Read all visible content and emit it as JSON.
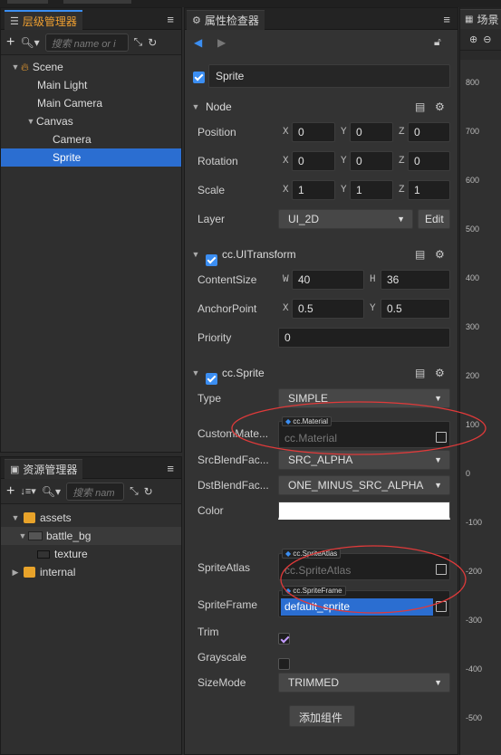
{
  "hierarchy": {
    "tab_label": "层级管理器",
    "search_placeholder": "搜索 name or i",
    "items": [
      {
        "label": "Scene",
        "depth": 0
      },
      {
        "label": "Main Light",
        "depth": 1
      },
      {
        "label": "Main Camera",
        "depth": 1
      },
      {
        "label": "Canvas",
        "depth": 1
      },
      {
        "label": "Camera",
        "depth": 2
      },
      {
        "label": "Sprite",
        "depth": 2,
        "selected": true
      }
    ]
  },
  "assets": {
    "tab_label": "资源管理器",
    "search_placeholder": "搜索 nam",
    "items": [
      {
        "label": "assets"
      },
      {
        "label": "battle_bg"
      },
      {
        "label": "texture"
      },
      {
        "label": "internal"
      }
    ]
  },
  "inspector": {
    "tab_label": "属性检查器",
    "node_name": "Sprite",
    "node_section": "Node",
    "position": {
      "label": "Position",
      "x": "0",
      "y": "0",
      "z": "0"
    },
    "rotation": {
      "label": "Rotation",
      "x": "0",
      "y": "0",
      "z": "0"
    },
    "scale": {
      "label": "Scale",
      "x": "1",
      "y": "1",
      "z": "1"
    },
    "layer": {
      "label": "Layer",
      "value": "UI_2D",
      "edit": "Edit"
    },
    "uitransform": {
      "title": "cc.UITransform",
      "content_size_label": "ContentSize",
      "w": "40",
      "h": "36",
      "anchor_label": "AnchorPoint",
      "ax": "0.5",
      "ay": "0.5",
      "priority_label": "Priority",
      "priority": "0"
    },
    "sprite": {
      "title": "cc.Sprite",
      "type_label": "Type",
      "type_value": "SIMPLE",
      "custom_material_label": "CustomMate...",
      "custom_material_tag": "cc.Material",
      "custom_material_value": "cc.Material",
      "src_blend_label": "SrcBlendFac...",
      "src_blend_value": "SRC_ALPHA",
      "dst_blend_label": "DstBlendFac...",
      "dst_blend_value": "ONE_MINUS_SRC_ALPHA",
      "color_label": "Color",
      "color_value": "#ffffff",
      "atlas_label": "SpriteAtlas",
      "atlas_tag": "cc.SpriteAtlas",
      "atlas_value": "cc.SpriteAtlas",
      "frame_label": "SpriteFrame",
      "frame_tag": "cc.SpriteFrame",
      "frame_value": "default_sprite",
      "trim_label": "Trim",
      "trim": true,
      "grayscale_label": "Grayscale",
      "grayscale": false,
      "sizemode_label": "SizeMode",
      "sizemode_value": "TRIMMED"
    },
    "add_component": "添加组件"
  },
  "scene_view": {
    "tab_label": "场景",
    "ruler": [
      "800",
      "700",
      "600",
      "500",
      "400",
      "300",
      "200",
      "100",
      "0",
      "-100",
      "-200",
      "-300",
      "-400",
      "-500"
    ]
  },
  "colors": {
    "accent": "#3b8ef2",
    "selection": "#2b6ed1",
    "annotation": "#e03a3a"
  }
}
